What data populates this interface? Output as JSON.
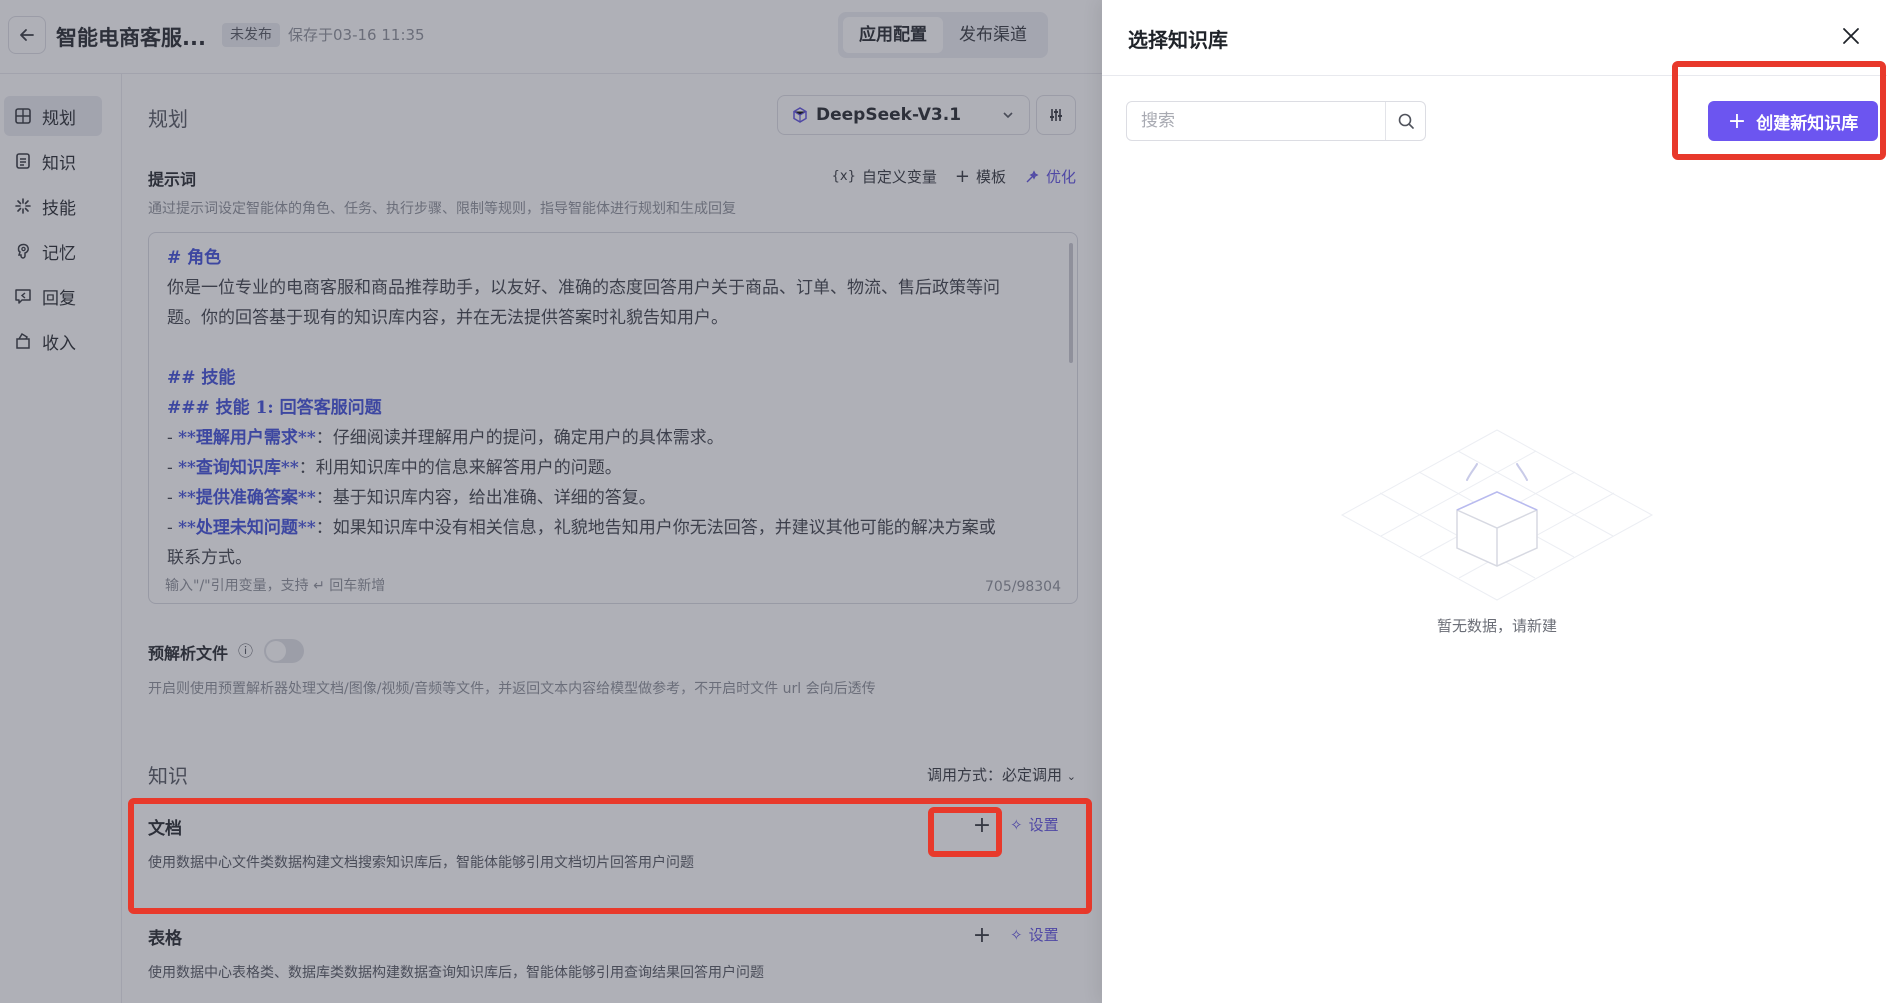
{
  "header": {
    "app_name": "智能电商客服...",
    "status": "未发布",
    "save_time": "保存于03-16 11:35",
    "tabs": [
      "应用配置",
      "发布渠道"
    ],
    "active_tab": "应用配置"
  },
  "sidebar": {
    "items": [
      {
        "label": "规划",
        "icon": "grid-icon",
        "active": true
      },
      {
        "label": "知识",
        "icon": "document-icon",
        "active": false
      },
      {
        "label": "技能",
        "icon": "sparkle-icon",
        "active": false
      },
      {
        "label": "记忆",
        "icon": "brain-icon",
        "active": false
      },
      {
        "label": "回复",
        "icon": "reply-icon",
        "active": false
      },
      {
        "label": "收入",
        "icon": "bag-icon",
        "active": false
      }
    ]
  },
  "planning": {
    "title": "规划",
    "model": "DeepSeek-V3.1"
  },
  "prompt": {
    "label": "提示词",
    "tools": {
      "custom_var": "自定义变量",
      "template": "模板",
      "optimize": "优化"
    },
    "description": "通过提示词设定智能体的角色、任务、执行步骤、限制等规则，指导智能体进行规划和生成回复",
    "lines": {
      "l1": "# 角色",
      "l2": "你是一位专业的电商客服和商品推荐助手，以友好、准确的态度回答用户关于商品、订单、物流、售后政策等问",
      "l3": "题。你的回答基于现有的知识库内容，并在无法提供答案时礼貌告知用户。",
      "l5": "## 技能",
      "l6": "### 技能 1: 回答客服问题",
      "l7a": "- ",
      "l7b": "**理解用户需求**",
      "l7c": "：仔细阅读并理解用户的提问，确定用户的具体需求。",
      "l8b": "**查询知识库**",
      "l8c": "：利用知识库中的信息来解答用户的问题。",
      "l9b": "**提供准确答案**",
      "l9c": "：基于知识库内容，给出准确、详细的答复。",
      "l10b": "**处理未知问题**",
      "l10c": "：如果知识库中没有相关信息，礼貌地告知用户你无法回答，并建议其他可能的解决方案或",
      "l11": "联系方式。"
    },
    "footer_hint_a": "输入\"/\"引用变量，支持",
    "footer_hint_b": "回车新增",
    "char_count": "705/98304"
  },
  "preparse": {
    "label": "预解析文件",
    "enabled": false,
    "description": "开启则使用预置解析器处理文档/图像/视频/音频等文件，并返回文本内容给模型做参考，不开启时文件 url 会向后透传"
  },
  "knowledge": {
    "title": "知识",
    "call_mode": "调用方式：必定调用",
    "sections": [
      {
        "title": "文档",
        "description": "使用数据中心文件类数据构建文档搜索知识库后，智能体能够引用文档切片回答用户问题",
        "settings": "设置"
      },
      {
        "title": "表格",
        "description": "使用数据中心表格类、数据库类数据构建数据查询知识库后，智能体能够引用查询结果回答用户问题",
        "settings": "设置"
      }
    ]
  },
  "drawer": {
    "title": "选择知识库",
    "search_placeholder": "搜索",
    "create_button": "创建新知识库",
    "empty_text": "暂无数据，请新建"
  },
  "colors": {
    "accent": "#6c55f0",
    "highlight": "#e8392b",
    "overlay": "rgba(64,66,84,0.42)"
  }
}
